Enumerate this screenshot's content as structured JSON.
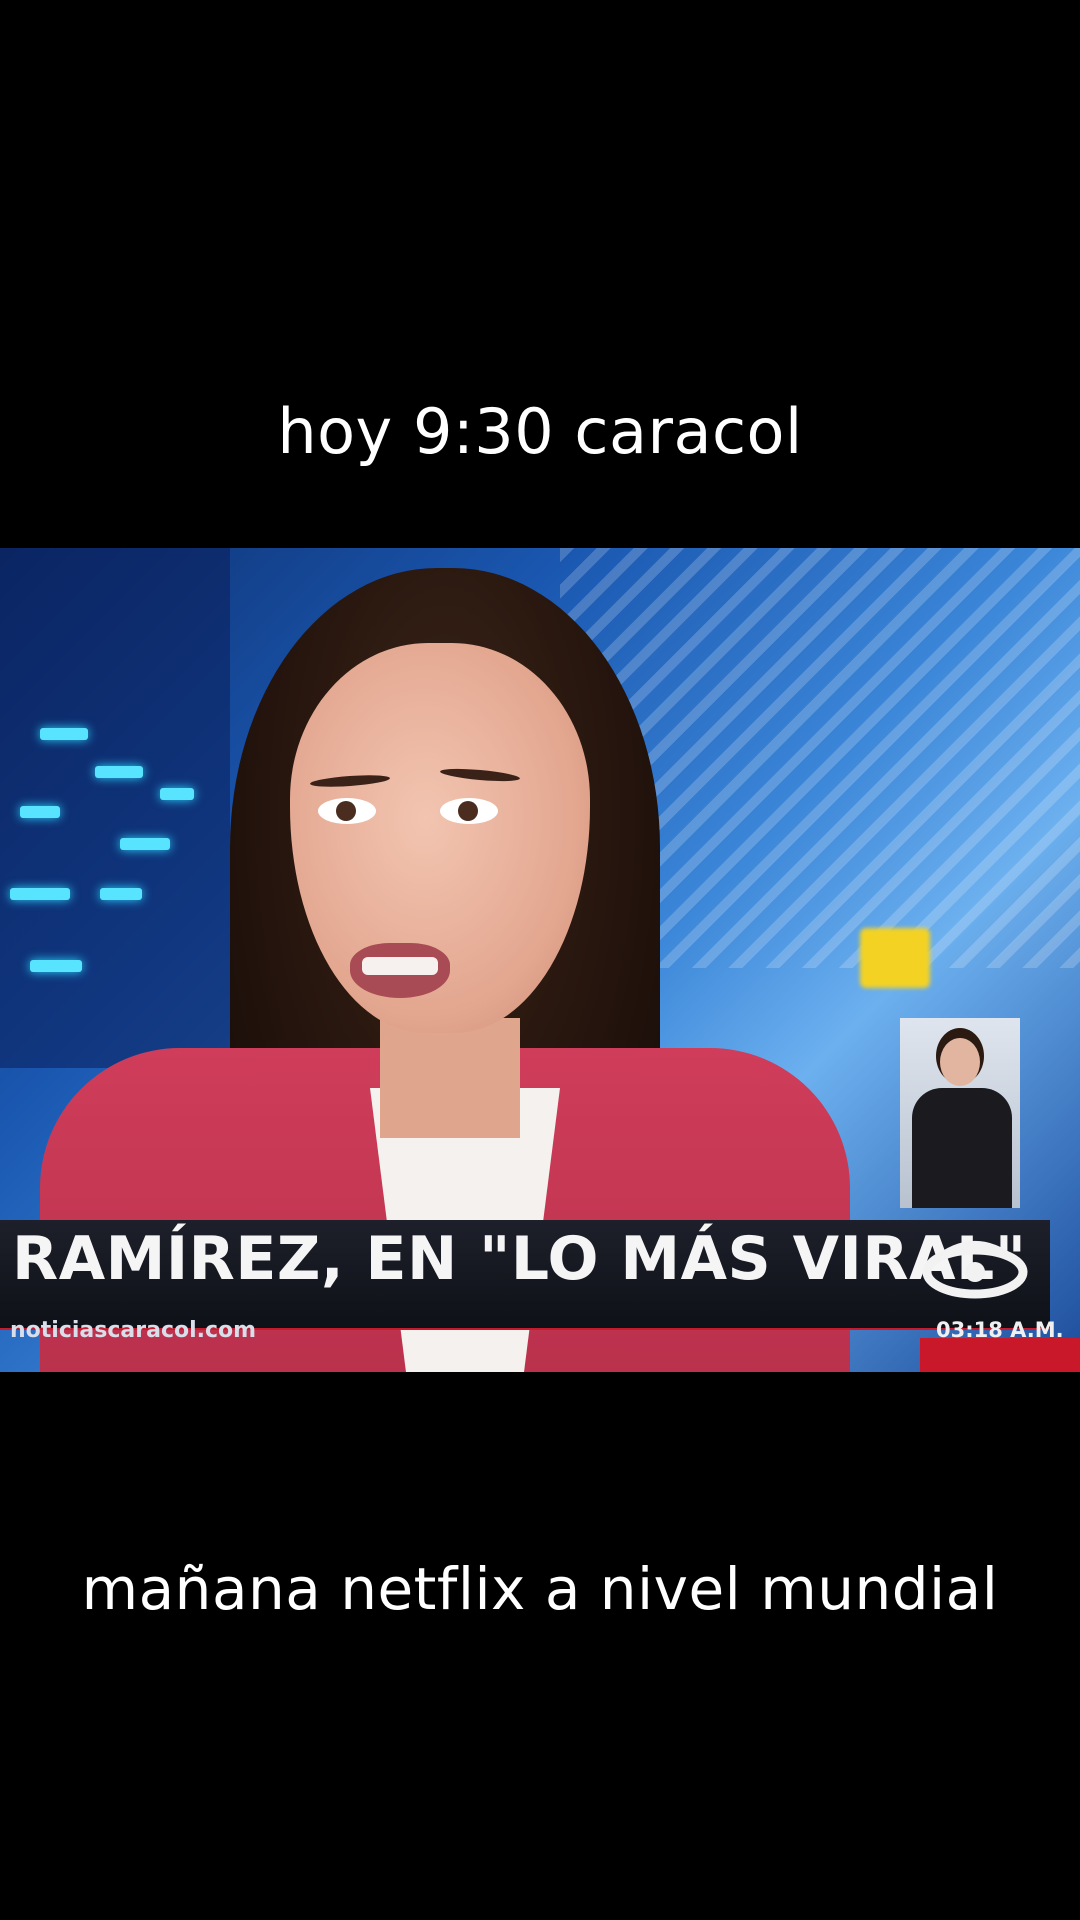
{
  "captions": {
    "top": "hoy 9:30 caracol",
    "bottom": "mañana netflix a nivel mundial"
  },
  "broadcast": {
    "headline": "RAMÍREZ, EN \"LO MÁS VIRAL\"",
    "website": "noticiascaracol.com",
    "time": "03:18 A.M.",
    "logo_icon": "caracol-logo-icon"
  },
  "colors": {
    "lower_third_bg": "#141620",
    "accent_red": "#c8182a",
    "jacket_pink": "#c93855"
  }
}
